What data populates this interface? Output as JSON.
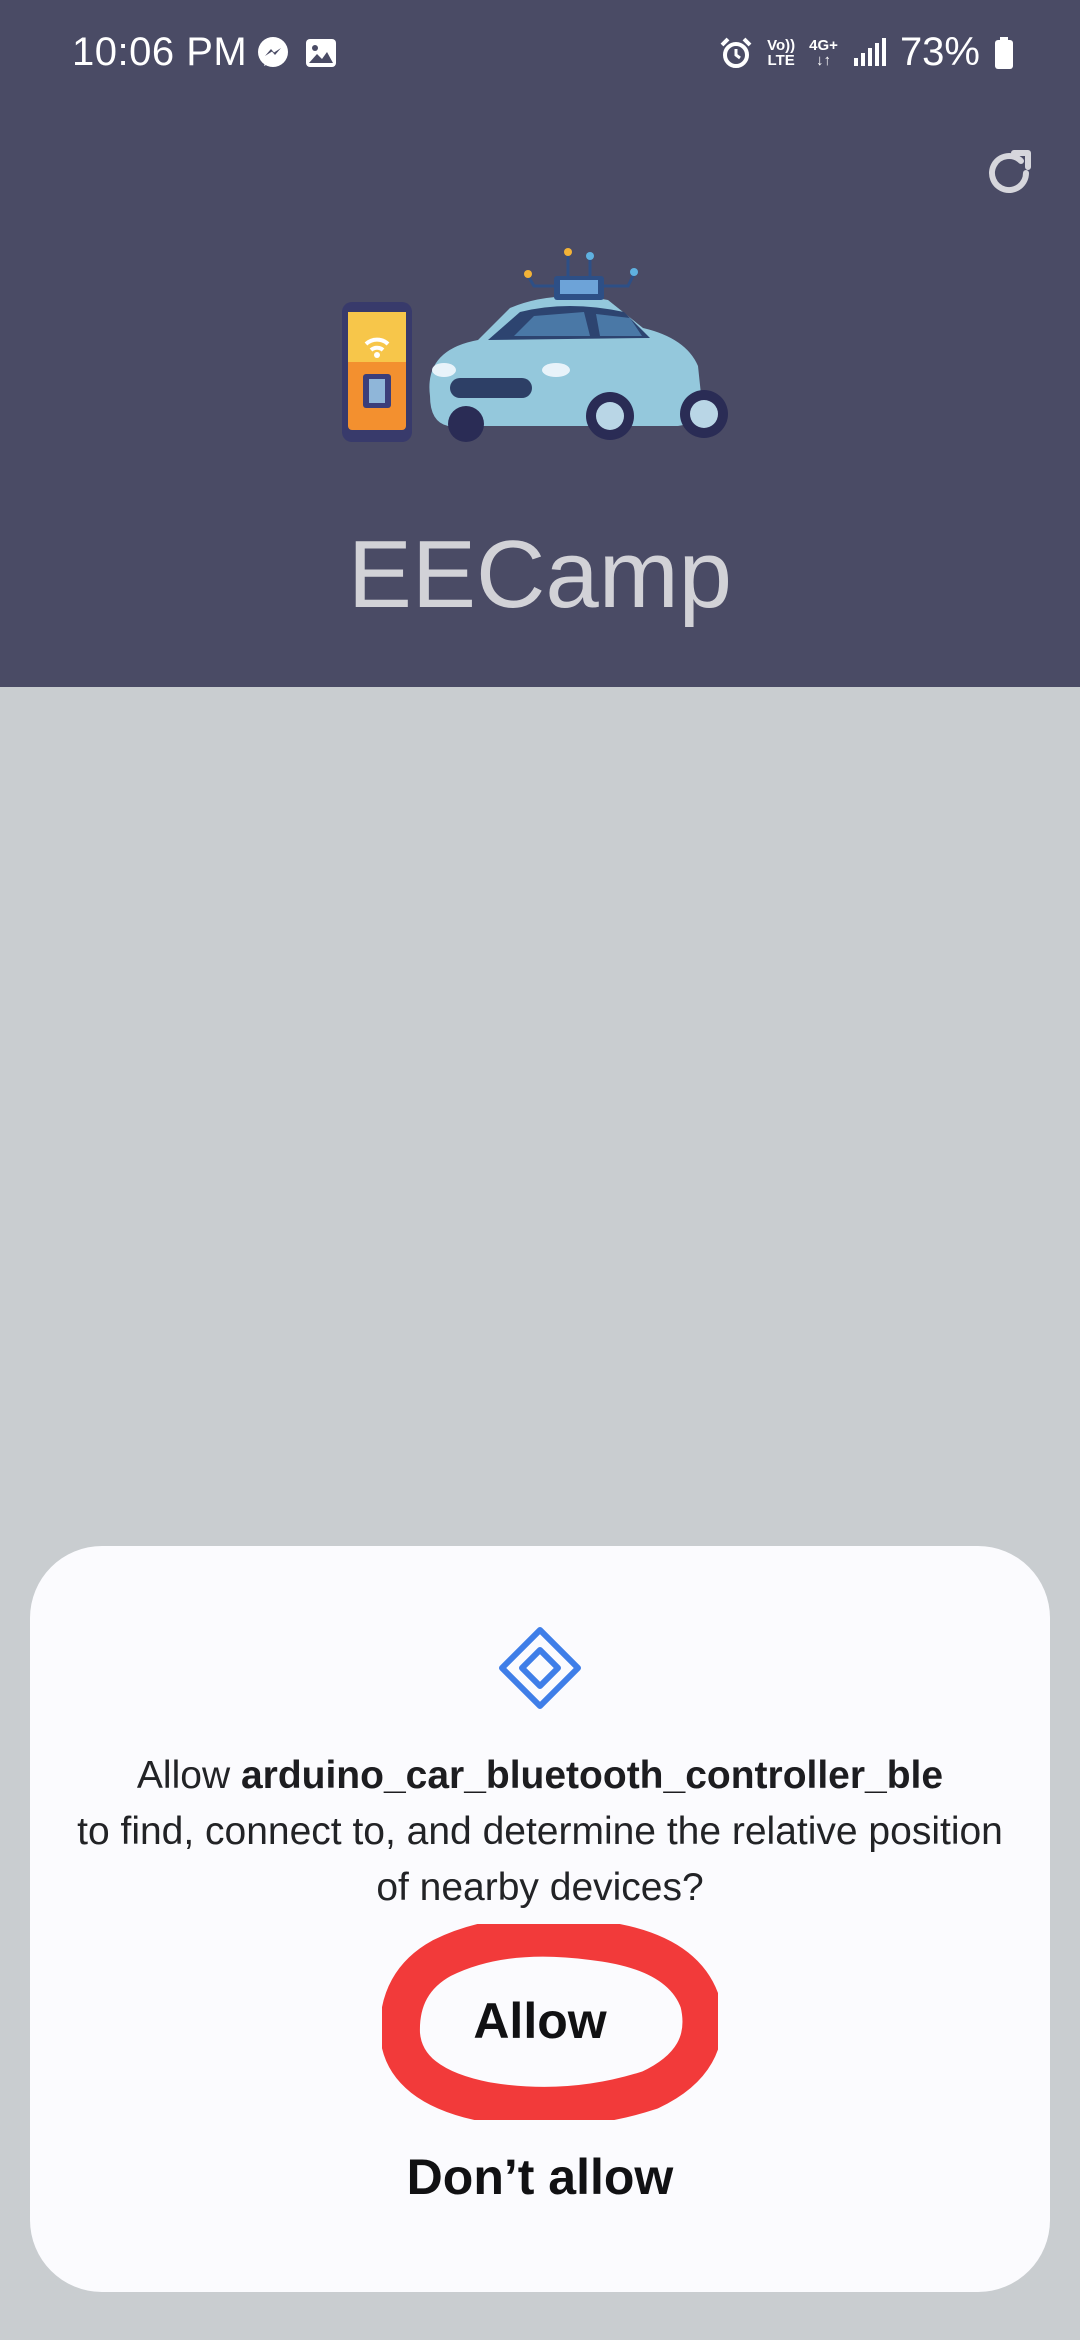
{
  "status_bar": {
    "time": "10:06 PM",
    "volte_label_top": "Vo))",
    "volte_label_bottom": "LTE",
    "network_label": "4G+",
    "network_arrows": "↓↑",
    "battery_percent": "73%",
    "icons": [
      "messenger-icon",
      "gallery-icon",
      "alarm-icon",
      "volte-icon",
      "network-4g-icon",
      "signal-icon",
      "battery-icon"
    ]
  },
  "header": {
    "app_title": "EECamp",
    "background_color": "#4a4b65",
    "refresh_icon": "refresh-icon"
  },
  "permission_dialog": {
    "icon": "nearby-devices-icon",
    "message_prefix": "Allow ",
    "app_package": "arduino_car_bluetooth_controller_ble",
    "message_suffix": "to find, connect to, and determine the relative position of nearby devices?",
    "allow_label": "Allow",
    "deny_label": "Don’t allow",
    "highlight_color": "#f23a3a"
  }
}
